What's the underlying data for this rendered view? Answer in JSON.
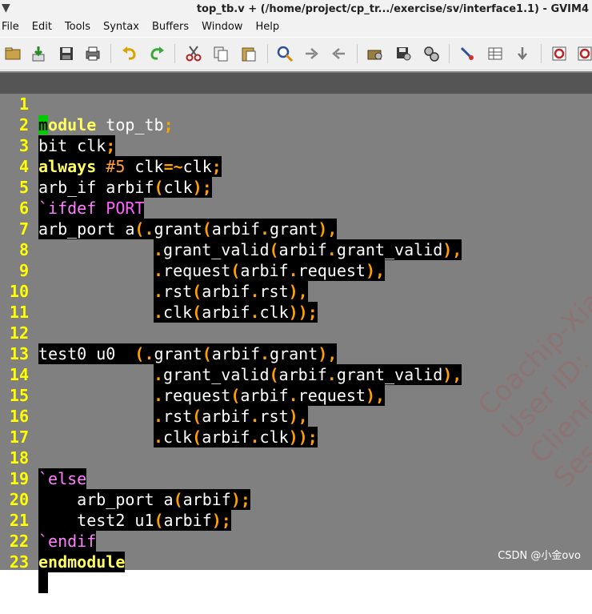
{
  "window": {
    "title": "top_tb.v + (/home/project/cp_tr.../exercise/sv/interface1.1) - GVIM4"
  },
  "menu": [
    "File",
    "Edit",
    "Tools",
    "Syntax",
    "Buffers",
    "Window",
    "Help"
  ],
  "toolbar": {
    "icons": [
      "open-icon",
      "save-download-icon",
      "save-icon",
      "print-icon",
      "undo-icon",
      "redo-icon",
      "cut-icon",
      "copy-icon",
      "paste-icon",
      "find-replace-icon",
      "forward-icon",
      "back-icon",
      "load-session-icon",
      "save-session-icon",
      "run-script-icon",
      "make-icon",
      "tags-icon",
      "jump-tag-icon",
      "help-icon",
      "find-help-icon"
    ]
  },
  "code": {
    "lines": [
      "module top_tb;",
      "bit clk;",
      "always #5 clk=~clk;",
      "arb_if arbif(clk);",
      "`ifdef PORT",
      "arb_port a(.grant(arbif.grant),",
      "            .grant_valid(arbif.grant_valid),",
      "            .request(arbif.request),",
      "            .rst(arbif.rst),",
      "            .clk(arbif.clk));",
      "",
      "test0 u0  (.grant(arbif.grant),",
      "            .grant_valid(arbif.grant_valid),",
      "            .request(arbif.request),",
      "            .rst(arbif.rst),",
      "            .clk(arbif.clk));",
      "",
      "`else",
      "    arb_port a(arbif);",
      "    test2 u1(arbif);",
      "`endif",
      "endmodule",
      ""
    ]
  },
  "watermark": {
    "texts": [
      "Coachip-Xia",
      "User ID:",
      "Client I",
      "Ses"
    ]
  },
  "footer": {
    "csdn_label": "CSDN @小金ovo"
  }
}
